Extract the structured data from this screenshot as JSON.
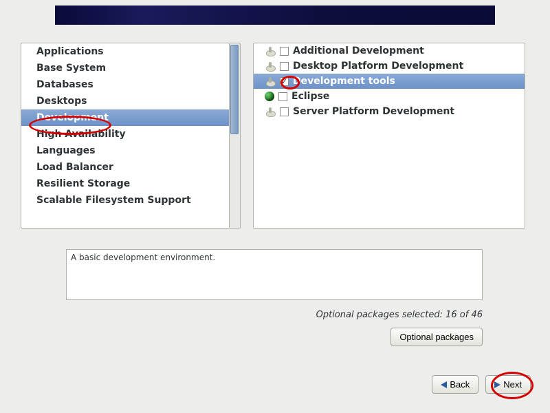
{
  "categories": [
    {
      "label": "Applications",
      "selected": false
    },
    {
      "label": "Base System",
      "selected": false
    },
    {
      "label": "Databases",
      "selected": false
    },
    {
      "label": "Desktops",
      "selected": false
    },
    {
      "label": "Development",
      "selected": true
    },
    {
      "label": "High Availability",
      "selected": false
    },
    {
      "label": "Languages",
      "selected": false
    },
    {
      "label": "Load Balancer",
      "selected": false
    },
    {
      "label": "Resilient Storage",
      "selected": false
    },
    {
      "label": "Scalable Filesystem Support",
      "selected": false
    }
  ],
  "groups": [
    {
      "label": "Additional Development",
      "checked": false,
      "selected": false,
      "icon": "package"
    },
    {
      "label": "Desktop Platform Development",
      "checked": false,
      "selected": false,
      "icon": "package"
    },
    {
      "label": "Development tools",
      "checked": true,
      "selected": true,
      "icon": "package"
    },
    {
      "label": "Eclipse",
      "checked": false,
      "selected": false,
      "icon": "globe"
    },
    {
      "label": "Server Platform Development",
      "checked": false,
      "selected": false,
      "icon": "package"
    }
  ],
  "description": "A basic development environment.",
  "status": "Optional packages selected: 16 of 46",
  "buttons": {
    "optional": "Optional packages",
    "back": "Back",
    "next": "Next"
  }
}
